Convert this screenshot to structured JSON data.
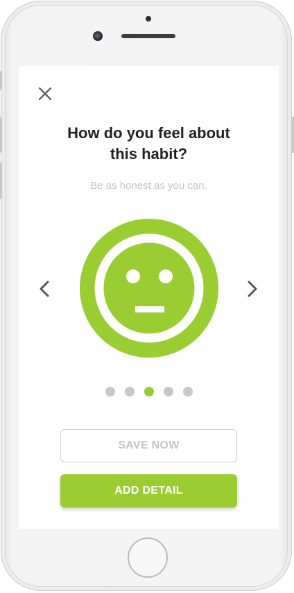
{
  "colors": {
    "accent": "#9acd32",
    "inactive_dot": "#c8c8c8",
    "title_text": "#222222",
    "muted_text": "#c4c4c4",
    "icon": "#555555"
  },
  "header": {
    "close_icon": "close-icon"
  },
  "prompt": {
    "title": "How do you feel about\nthis habit?",
    "subtitle": "Be as honest as you can."
  },
  "mood_selector": {
    "current_face": "neutral-face-icon",
    "prev_icon": "chevron-left-icon",
    "next_icon": "chevron-right-icon",
    "total_options": 5,
    "selected_index": 2
  },
  "actions": {
    "save_label": "SAVE NOW",
    "detail_label": "ADD DETAIL"
  }
}
